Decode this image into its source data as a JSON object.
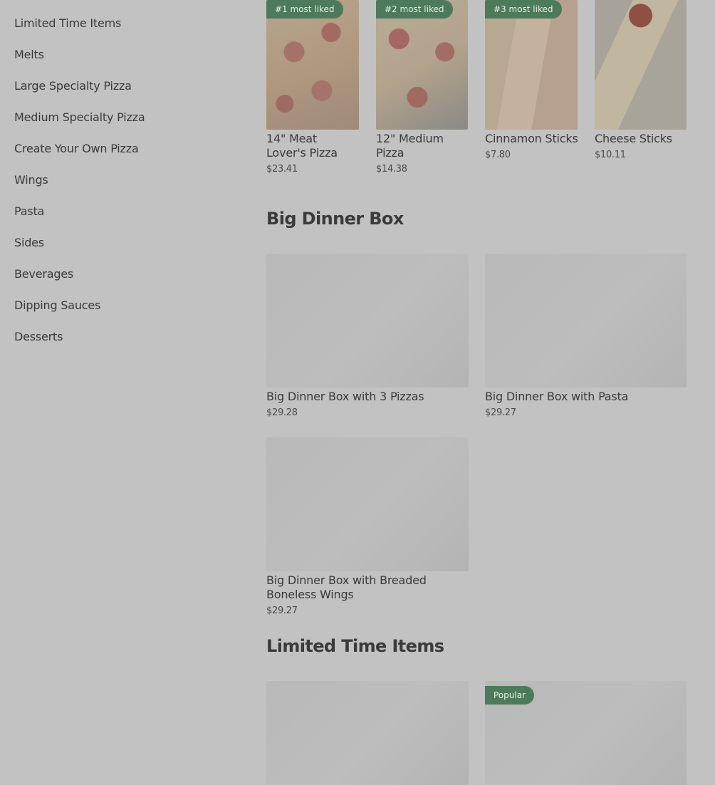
{
  "sidebar": {
    "items": [
      {
        "label": "Limited Time Items"
      },
      {
        "label": "Melts"
      },
      {
        "label": "Large Specialty Pizza"
      },
      {
        "label": "Medium Specialty Pizza"
      },
      {
        "label": "Create Your Own Pizza"
      },
      {
        "label": "Wings"
      },
      {
        "label": "Pasta"
      },
      {
        "label": "Sides"
      },
      {
        "label": "Beverages"
      },
      {
        "label": "Dipping Sauces"
      },
      {
        "label": "Desserts"
      }
    ]
  },
  "featured": {
    "items": [
      {
        "badge": "#1 most liked",
        "name": "14\" Meat Lover's Pizza",
        "price": "$23.41"
      },
      {
        "badge": "#2 most liked",
        "name": "12\" Medium Pizza",
        "price": "$14.38"
      },
      {
        "badge": "#3 most liked",
        "name": "Cinnamon Sticks",
        "price": "$7.80"
      },
      {
        "name": "Cheese Sticks",
        "price": "$10.11"
      }
    ]
  },
  "big_dinner_box": {
    "title": "Big Dinner Box",
    "items": [
      {
        "name": "Big Dinner Box with 3 Pizzas",
        "price": "$29.28"
      },
      {
        "name": "Big Dinner Box with Pasta",
        "price": "$29.27"
      },
      {
        "name": "Big Dinner Box with Breaded Boneless Wings",
        "price": "$29.27"
      }
    ]
  },
  "limited_time": {
    "title": "Limited Time Items",
    "items": [
      {},
      {
        "badge": "Popular"
      }
    ]
  },
  "colors": {
    "overlay_background": "#c2c2c2",
    "badge_green": "#4d7a5a"
  }
}
